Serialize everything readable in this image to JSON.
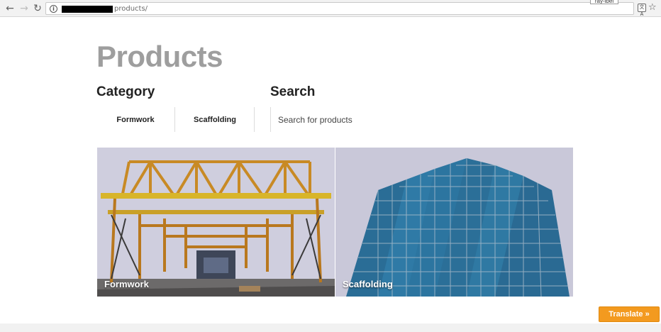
{
  "browser": {
    "back_icon": "arrow-left-icon",
    "forward_icon": "arrow-right-icon",
    "reload_icon": "reload-icon",
    "url_path": "products/",
    "tooltip": "ray-ibel",
    "translate_icon_label": "文A",
    "star_icon": "star-icon"
  },
  "page": {
    "title": "Products"
  },
  "category": {
    "heading": "Category",
    "items": [
      {
        "label": "Formwork"
      },
      {
        "label": "Scaffolding"
      }
    ]
  },
  "search": {
    "heading": "Search",
    "placeholder": "Search for products",
    "value": ""
  },
  "cards": [
    {
      "label": "Formwork",
      "image": "formwork-structure-photo"
    },
    {
      "label": "Scaffolding",
      "image": "scaffolded-building-photo"
    }
  ],
  "translate": {
    "label": "Translate »",
    "color": "#f39a1f"
  }
}
